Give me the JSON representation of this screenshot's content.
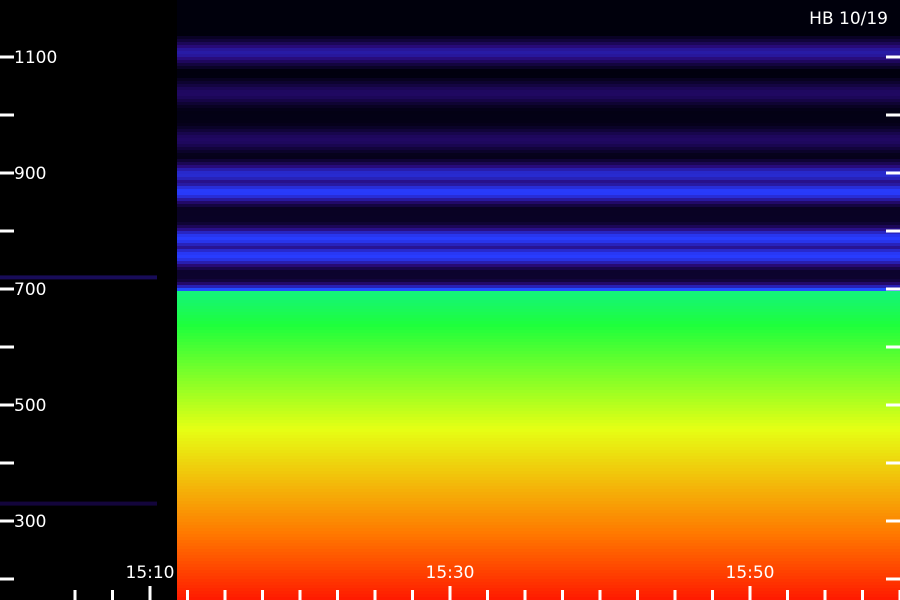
{
  "chart_data": {
    "type": "heatmap",
    "title": "HB 10/19",
    "xlabel": "",
    "ylabel": "",
    "x_range_minutes": [
      6,
      26
    ],
    "y_range": [
      180,
      1215
    ],
    "x_major_ticks": [
      {
        "t": 10,
        "label": "15:10"
      },
      {
        "t": 30,
        "label": "15:30"
      },
      {
        "t": 50,
        "label": "15:50"
      }
    ],
    "x_minor_ticks": [
      5,
      7.5,
      12.5,
      15,
      17.5,
      20,
      22.5,
      25,
      27.5,
      32.5,
      35,
      37.5,
      40,
      42.5,
      45,
      47.5,
      52.5,
      55,
      57.5,
      60
    ],
    "y_major_ticks": [
      300,
      500,
      700,
      900,
      1100
    ],
    "y_minor_ticks": [
      200,
      400,
      600,
      800,
      1000
    ],
    "onset_time": "15:11",
    "bands_after_onset": [
      {
        "y": 1110,
        "intensity": 0.2
      },
      {
        "y": 1040,
        "intensity": 0.12
      },
      {
        "y": 960,
        "intensity": 0.12
      },
      {
        "y": 900,
        "intensity": 0.25
      },
      {
        "y": 870,
        "intensity": 0.3
      },
      {
        "y": 790,
        "intensity": 0.3
      },
      {
        "y": 760,
        "intensity": 0.3
      },
      {
        "y": 690,
        "intensity": 0.45
      },
      {
        "y": 640,
        "intensity": 0.55
      },
      {
        "y": 560,
        "intensity": 0.62
      },
      {
        "y": 480,
        "intensity": 0.7
      },
      {
        "y": 400,
        "intensity": 0.7
      },
      {
        "y": 340,
        "intensity": 0.65
      },
      {
        "y": 280,
        "intensity": 0.85
      },
      {
        "y": 200,
        "intensity": 0.8
      }
    ],
    "colors": {
      "low": "#000010",
      "blue": "#2030ff",
      "cyan": "#00e0ff",
      "green": "#20ff20",
      "yellow": "#ffff00",
      "red": "#ff2000"
    }
  }
}
